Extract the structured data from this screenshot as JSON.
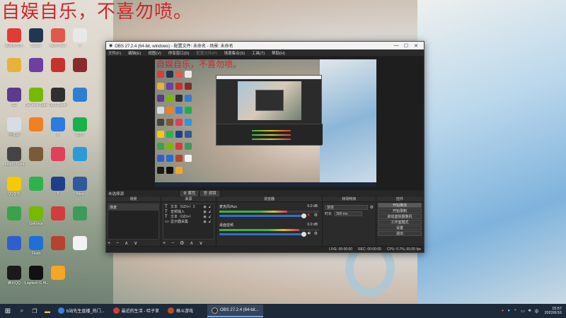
{
  "desktop": {
    "headline": "自娱自乐，不喜勿喷。",
    "icons": [
      {
        "label": "网易云音乐",
        "color": "#e23a34"
      },
      {
        "label": "Steam",
        "color": "#23364f"
      },
      {
        "label": "ADR Hero",
        "color": "#e0584a"
      },
      {
        "label": "1",
        "color": "#e8e8e8"
      },
      {
        "label": "",
        "color": "#e8b13a"
      },
      {
        "label": "",
        "color": "#6c3fa0"
      },
      {
        "label": "",
        "color": "#c8322d"
      },
      {
        "label": "",
        "color": "#8a2b2b"
      },
      {
        "label": "SE",
        "color": "#5b3a8f"
      },
      {
        "label": "GeForce Experience",
        "color": "#76b900"
      },
      {
        "label": "OBS Studio",
        "color": "#303030"
      },
      {
        "label": "",
        "color": "#2e7fd2"
      },
      {
        "label": "回收站",
        "color": "#d8dde4"
      },
      {
        "label": "",
        "color": "#f08020"
      },
      {
        "label": "K",
        "color": "#2b7be0"
      },
      {
        "label": "iQIYI",
        "color": "#18b24b"
      },
      {
        "label": "Modern Combat 5",
        "color": "#444"
      },
      {
        "label": "",
        "color": "#7b5a3a"
      },
      {
        "label": "",
        "color": "#e0405a"
      },
      {
        "label": "",
        "color": "#2a9ad8"
      },
      {
        "label": "QQ音乐",
        "color": "#f7c900"
      },
      {
        "label": "",
        "color": "#2fb24b"
      },
      {
        "label": "5",
        "color": "#1e3f8a"
      },
      {
        "label": "Alien",
        "color": "#2c5a9b"
      },
      {
        "label": "",
        "color": "#3aa24a"
      },
      {
        "label": "GeForce",
        "color": "#76b900"
      },
      {
        "label": "",
        "color": "#d23c3c"
      },
      {
        "label": "",
        "color": "#3a9b5a"
      },
      {
        "label": "",
        "color": "#2f5fcf"
      },
      {
        "label": "Flash",
        "color": "#1f6fd6"
      },
      {
        "label": "",
        "color": "#b6432f"
      },
      {
        "label": "",
        "color": "#f2f2f2"
      },
      {
        "label": "腾讯QQ",
        "color": "#1a1a1a"
      },
      {
        "label": "Logitech G HUB",
        "color": "#111"
      },
      {
        "label": "",
        "color": "#f5a623"
      }
    ]
  },
  "obs": {
    "title": "OBS 27.2.4 (64-bit, windows) - 配置文件: 未命名 - 场景: 未命名",
    "window_buttons": [
      "—",
      "☐",
      "✕"
    ],
    "menu": [
      "文件(F)",
      "编辑(E)",
      "视图(V)",
      "停靠窗口(D)",
      "配置文件(P)",
      "场景集合(S)",
      "工具(T)",
      "帮助(H)"
    ],
    "source_bar": {
      "no_source": "未选择源",
      "properties": "⚙ 属性",
      "filters": "▦ 滤镜"
    },
    "docks": {
      "scenes": {
        "title": "场景",
        "items": [
          "场景"
        ],
        "footer": "+ − ∧ ∨"
      },
      "sources": {
        "title": "来源",
        "items": [
          {
            "icon": "T",
            "label": "文本（GDI+）2"
          },
          {
            "icon": "T",
            "label": "音频输入"
          },
          {
            "icon": "T",
            "label": "文本（GDI+）"
          },
          {
            "icon": "▭",
            "label": "显示器采集"
          }
        ],
        "footer": "+ − ⚙ ∧ ∨"
      },
      "mixer": {
        "title": "混音器",
        "tracks": [
          {
            "name": "麦克风/Aux",
            "db": "0.0 dB",
            "level": 0.68,
            "volume": 0.98
          },
          {
            "name": "桌面音频",
            "db": "0.0 dB",
            "level": 0.8,
            "volume": 0.98
          }
        ]
      },
      "transitions": {
        "title": "转场特效",
        "type": "渐变",
        "duration_label": "时长",
        "duration": "300 ms"
      },
      "controls": {
        "title": "控件",
        "buttons": [
          "开始推流",
          "开始录制",
          "启动虚拟摄像机",
          "工作室模式",
          "设置",
          "退出"
        ]
      }
    },
    "status": {
      "live": "LIVE: 00:00:00",
      "rec": "REC: 00:00:00",
      "cpu": "CPU: 0.7%, 60.00 fps"
    }
  },
  "taskbar": {
    "apps": [
      {
        "label": "b站先生直播_热门...",
        "color": "#3b82e0",
        "active": false
      },
      {
        "label": "最近的生活 - 哈子草",
        "color": "#d23c3c",
        "active": false
      },
      {
        "label": "格斗游戏",
        "color": "#c04a24",
        "active": false
      },
      {
        "label": "OBS 27.2.4 (64-bit...",
        "color": "#303030",
        "active": true
      }
    ],
    "time": "15:57",
    "date": "2022/6/16"
  }
}
